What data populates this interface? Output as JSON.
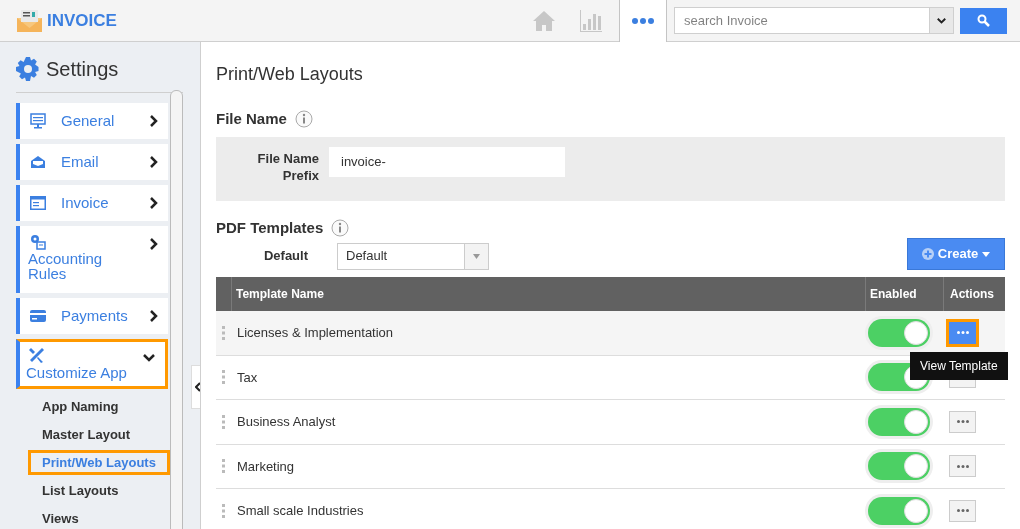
{
  "app": {
    "title": "INVOICE"
  },
  "search": {
    "placeholder": "search Invoice"
  },
  "sidebar": {
    "title": "Settings",
    "items": [
      {
        "label": "General",
        "selected": false,
        "expanded": false
      },
      {
        "label": "Email",
        "selected": false,
        "expanded": false
      },
      {
        "label": "Invoice",
        "selected": false,
        "expanded": false
      },
      {
        "label": "Accounting Rules",
        "selected": false,
        "expanded": false
      },
      {
        "label": "Payments",
        "selected": false,
        "expanded": false
      },
      {
        "label": "Customize App",
        "selected": true,
        "expanded": true,
        "children": [
          {
            "label": "App Naming",
            "selected": false
          },
          {
            "label": "Master Layout",
            "selected": false
          },
          {
            "label": "Print/Web Layouts",
            "selected": true
          },
          {
            "label": "List Layouts",
            "selected": false
          },
          {
            "label": "Views",
            "selected": false
          }
        ]
      }
    ]
  },
  "page": {
    "title": "Print/Web Layouts",
    "file_name": {
      "heading": "File Name",
      "label": "File Name Prefix",
      "value": "invoice-"
    },
    "pdf_templates": {
      "heading": "PDF Templates",
      "default_label": "Default",
      "default_value": "Default",
      "create_button": "Create",
      "columns": [
        "Template Name",
        "Enabled",
        "Actions"
      ],
      "rows": [
        {
          "name": "Licenses & Implementation",
          "enabled": true,
          "selected": true
        },
        {
          "name": "Tax",
          "enabled": true,
          "selected": false
        },
        {
          "name": "Business Analyst",
          "enabled": true,
          "selected": false
        },
        {
          "name": "Marketing",
          "enabled": true,
          "selected": false
        },
        {
          "name": "Small scale Industries",
          "enabled": true,
          "selected": false
        }
      ],
      "tooltip": "View Template"
    }
  }
}
